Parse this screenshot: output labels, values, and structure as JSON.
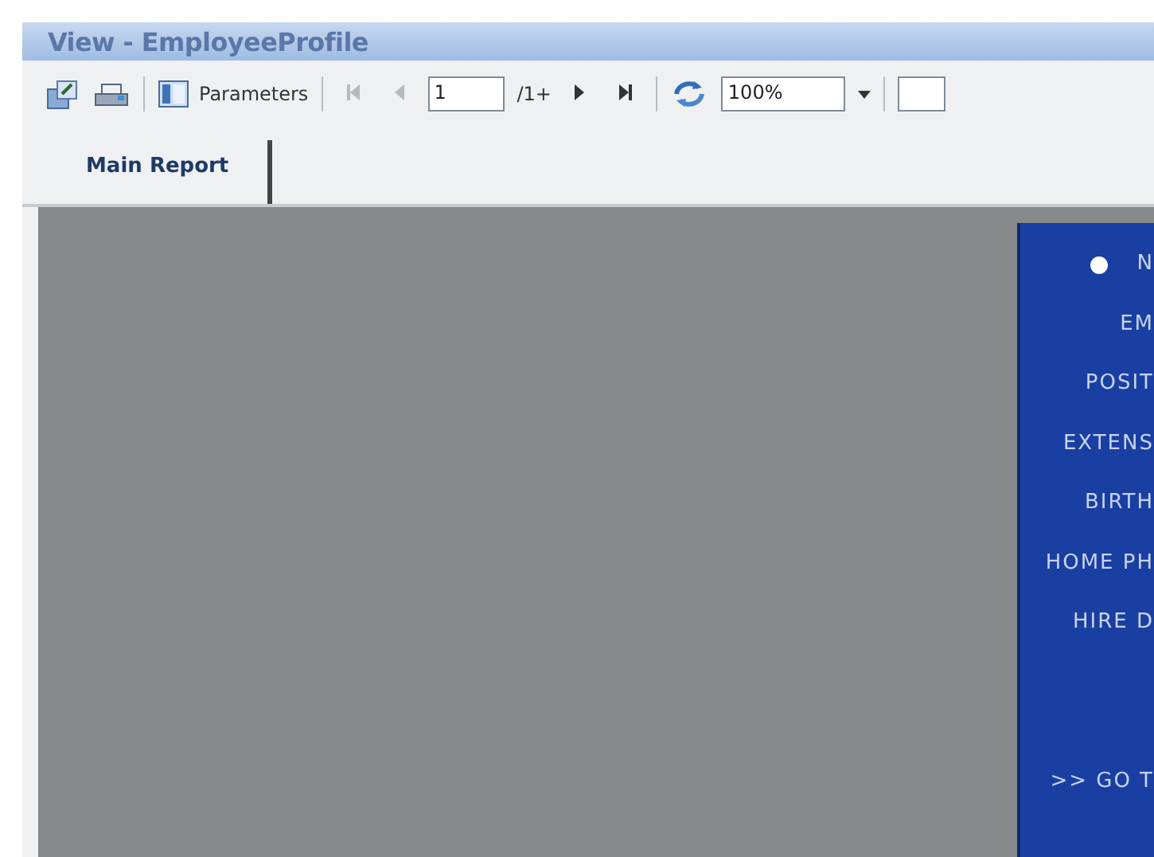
{
  "window": {
    "title": "View - EmployeeProfile"
  },
  "toolbar": {
    "parameters_label": "Parameters",
    "nav": [
      {
        "kind": "first",
        "disabled": true
      },
      {
        "kind": "prev",
        "disabled": true
      }
    ],
    "page_value": "1",
    "page_count": "/1+",
    "nav_after": [
      {
        "kind": "next",
        "disabled": false
      },
      {
        "kind": "last",
        "disabled": false
      }
    ],
    "zoom_value": "100%"
  },
  "tabs": [
    {
      "label": "Main Report",
      "selected": true
    }
  ],
  "report_panel": {
    "items": [
      {
        "label": "N",
        "bullet": true
      },
      {
        "label": "EM",
        "bullet": false
      },
      {
        "label": "POSIT",
        "bullet": false
      },
      {
        "label": "EXTENS",
        "bullet": false
      },
      {
        "label": "BIRTH",
        "bullet": false
      },
      {
        "label": "HOME PH",
        "bullet": false
      },
      {
        "label": "HIRE D",
        "bullet": false
      }
    ],
    "link": ">> GO T"
  }
}
